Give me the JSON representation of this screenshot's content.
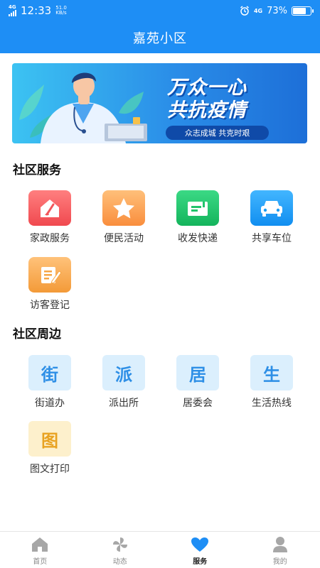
{
  "status_bar": {
    "network": "4G",
    "time": "12:33",
    "speed_value": "51.0",
    "speed_unit": "KB/s",
    "right_network": "4G",
    "battery": "73%",
    "battery_level": 0.73
  },
  "header": {
    "title": "嘉苑小区"
  },
  "banner": {
    "line1": "万众一心",
    "line2": "共抗疫情",
    "subtitle": "众志成城 共克时艰"
  },
  "community_services": {
    "title": "社区服务",
    "items": [
      {
        "label": "家政服务",
        "icon": "house-broom-icon",
        "color": "#f2565a"
      },
      {
        "label": "便民活动",
        "icon": "star-icon",
        "color": "#fb9e4b"
      },
      {
        "label": "收发快递",
        "icon": "package-icon",
        "color": "#21c46c"
      },
      {
        "label": "共享车位",
        "icon": "car-icon",
        "color": "#199cf3"
      },
      {
        "label": "访客登记",
        "icon": "register-icon",
        "color": "#f6a645"
      }
    ]
  },
  "community_nearby": {
    "title": "社区周边",
    "items": [
      {
        "label": "街道办",
        "char": "街",
        "color": "#2e8fe6",
        "bg": "#dbeffd"
      },
      {
        "label": "派出所",
        "char": "派",
        "color": "#2e8fe6",
        "bg": "#dbeffd"
      },
      {
        "label": "居委会",
        "char": "居",
        "color": "#2e8fe6",
        "bg": "#dbeffd"
      },
      {
        "label": "生活热线",
        "char": "生",
        "color": "#2e8fe6",
        "bg": "#dbeffd"
      },
      {
        "label": "图文打印",
        "char": "图",
        "color": "#e8a221",
        "bg": "#fdf0cc"
      }
    ]
  },
  "tabbar": {
    "tabs": [
      {
        "label": "首页",
        "icon": "home-icon",
        "active": false
      },
      {
        "label": "动态",
        "icon": "pinwheel-icon",
        "active": false
      },
      {
        "label": "服务",
        "icon": "heart-icon",
        "active": true
      },
      {
        "label": "我的",
        "icon": "person-icon",
        "active": false
      }
    ]
  }
}
